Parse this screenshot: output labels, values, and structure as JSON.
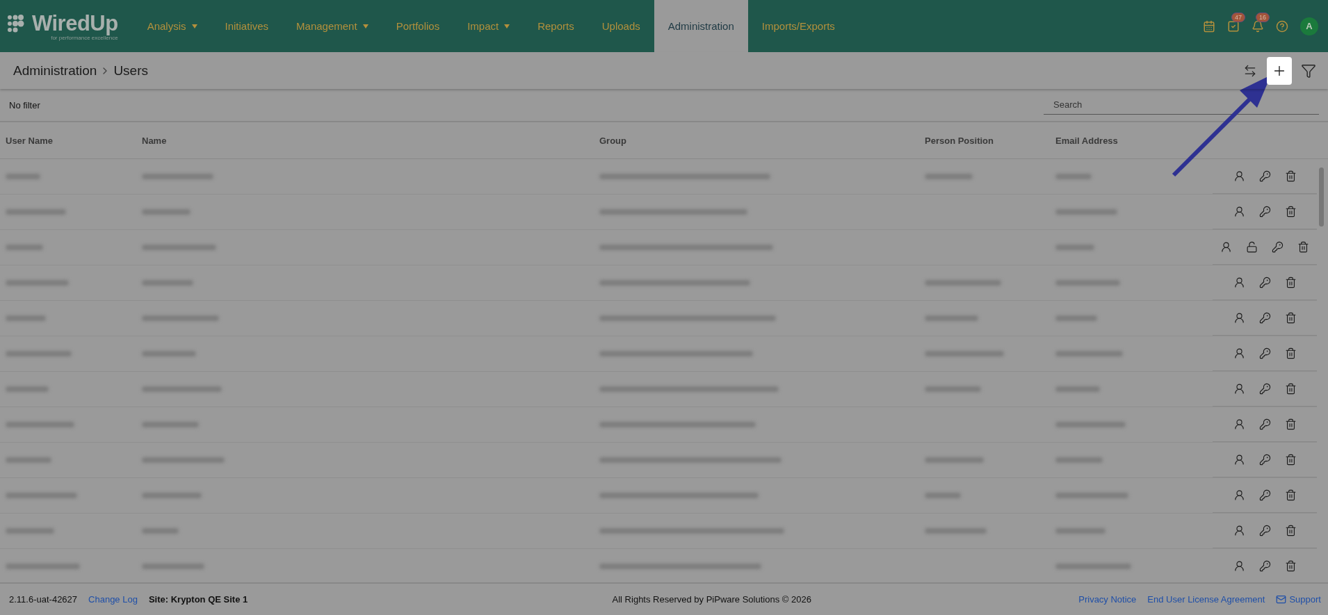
{
  "header": {
    "logo": {
      "name": "WiredUp",
      "tagline": "for performance excellence"
    },
    "nav": [
      {
        "label": "Analysis",
        "dropdown": true,
        "selected": false
      },
      {
        "label": "Initiatives",
        "dropdown": false,
        "selected": false
      },
      {
        "label": "Management",
        "dropdown": true,
        "selected": false
      },
      {
        "label": "Portfolios",
        "dropdown": false,
        "selected": false
      },
      {
        "label": "Impact",
        "dropdown": true,
        "selected": false
      },
      {
        "label": "Reports",
        "dropdown": false,
        "selected": false
      },
      {
        "label": "Uploads",
        "dropdown": false,
        "selected": false
      },
      {
        "label": "Administration",
        "dropdown": false,
        "selected": true
      },
      {
        "label": "Imports/Exports",
        "dropdown": false,
        "selected": false
      }
    ],
    "icons": [
      {
        "kind": "calendar"
      },
      {
        "kind": "tasks",
        "badge": "47"
      },
      {
        "kind": "bell",
        "badge": "16"
      },
      {
        "kind": "help"
      }
    ],
    "avatar": "A"
  },
  "breadcrumb": [
    "Administration",
    "Users"
  ],
  "toolbar": [
    {
      "kind": "swap",
      "highlighted": false
    },
    {
      "kind": "add",
      "highlighted": true
    },
    {
      "kind": "filter",
      "highlighted": false
    }
  ],
  "filter_text": "No filter",
  "search": {
    "placeholder": "Search"
  },
  "table": {
    "columns": [
      "User Name",
      "Name",
      "Group",
      "Person Position",
      "Email Address"
    ],
    "rows": [
      {
        "position_shown": true,
        "locked": false
      },
      {
        "position_shown": false,
        "locked": false
      },
      {
        "position_shown": false,
        "locked": true
      },
      {
        "position_shown": true,
        "locked": false
      },
      {
        "position_shown": true,
        "locked": false
      },
      {
        "position_shown": true,
        "locked": false
      },
      {
        "position_shown": true,
        "locked": false
      },
      {
        "position_shown": false,
        "locked": false
      },
      {
        "position_shown": true,
        "locked": false
      },
      {
        "position_shown": true,
        "locked": false
      },
      {
        "position_shown": true,
        "locked": false
      },
      {
        "position_shown": false,
        "locked": false
      }
    ]
  },
  "footer": {
    "version": "2.11.6-uat-42627",
    "change_log": "Change Log",
    "site": "Site: Krypton QE Site 1",
    "copyright": "All Rights Reserved by PiPware Solutions © 2026",
    "links": [
      "Privacy Notice",
      "End User License Agreement"
    ],
    "support": "Support"
  }
}
